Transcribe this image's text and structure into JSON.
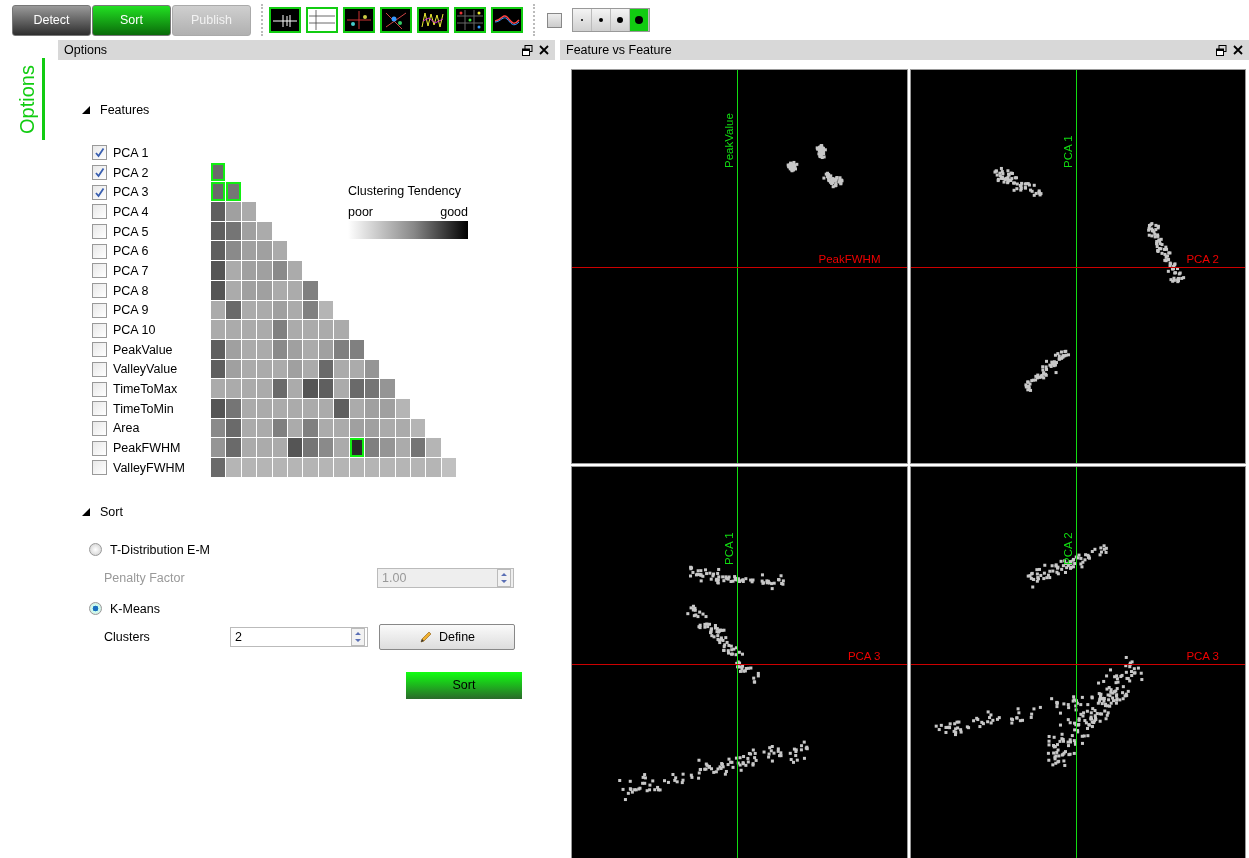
{
  "toolbar": {
    "modes": [
      {
        "label": "Detect",
        "selected": false,
        "disabled": false
      },
      {
        "label": "Sort",
        "selected": true,
        "disabled": false
      },
      {
        "label": "Publish",
        "selected": false,
        "disabled": true
      }
    ],
    "color_toggle": {
      "checked": false
    },
    "point_sizes": [
      {
        "selected": false
      },
      {
        "selected": false
      },
      {
        "selected": false
      },
      {
        "selected": true
      }
    ]
  },
  "side_tab": {
    "label": "Options",
    "selected": true
  },
  "options_panel": {
    "title": "Options",
    "features_section": {
      "title": "Features",
      "expanded": true
    },
    "features": [
      {
        "label": "PCA 1",
        "checked": true
      },
      {
        "label": "PCA 2",
        "checked": true,
        "cells": [
          {
            "color": "#6a6a6a",
            "selected": true
          }
        ]
      },
      {
        "label": "PCA 3",
        "checked": true,
        "cells": [
          {
            "color": "#6a6a6a",
            "selected": true
          },
          {
            "color": "#757575",
            "selected": true
          }
        ]
      },
      {
        "label": "PCA 4",
        "checked": false,
        "cells": [
          {
            "color": "#5f5f5f",
            "selected": false
          },
          {
            "color": "#a0a0a0",
            "selected": false
          },
          {
            "color": "#ababab",
            "selected": false
          }
        ]
      },
      {
        "label": "PCA 5",
        "checked": false,
        "cells": [
          {
            "color": "#5f5f5f",
            "selected": false
          },
          {
            "color": "#757575",
            "selected": false
          },
          {
            "color": "#a0a0a0",
            "selected": false
          },
          {
            "color": "#ababab",
            "selected": false
          }
        ]
      },
      {
        "label": "PCA 6",
        "checked": false,
        "cells": [
          {
            "color": "#5f5f5f",
            "selected": false
          },
          {
            "color": "#8a8a8a",
            "selected": false
          },
          {
            "color": "#a0a0a0",
            "selected": false
          },
          {
            "color": "#a0a0a0",
            "selected": false
          },
          {
            "color": "#ababab",
            "selected": false
          }
        ]
      },
      {
        "label": "PCA 7",
        "checked": false,
        "cells": [
          {
            "color": "#555555",
            "selected": false
          },
          {
            "color": "#ababab",
            "selected": false
          },
          {
            "color": "#a0a0a0",
            "selected": false
          },
          {
            "color": "#a0a0a0",
            "selected": false
          },
          {
            "color": "#8a8a8a",
            "selected": false
          },
          {
            "color": "#ababab",
            "selected": false
          }
        ]
      },
      {
        "label": "PCA 8",
        "checked": false,
        "cells": [
          {
            "color": "#555555",
            "selected": false
          },
          {
            "color": "#ababab",
            "selected": false
          },
          {
            "color": "#a0a0a0",
            "selected": false
          },
          {
            "color": "#a0a0a0",
            "selected": false
          },
          {
            "color": "#ababab",
            "selected": false
          },
          {
            "color": "#ababab",
            "selected": false
          },
          {
            "color": "#808080",
            "selected": false
          }
        ]
      },
      {
        "label": "PCA 9",
        "checked": false,
        "cells": [
          {
            "color": "#ababab",
            "selected": false
          },
          {
            "color": "#6a6a6a",
            "selected": false
          },
          {
            "color": "#ababab",
            "selected": false
          },
          {
            "color": "#ababab",
            "selected": false
          },
          {
            "color": "#a0a0a0",
            "selected": false
          },
          {
            "color": "#ababab",
            "selected": false
          },
          {
            "color": "#808080",
            "selected": false
          },
          {
            "color": "#b5b5b5",
            "selected": false
          }
        ]
      },
      {
        "label": "PCA 10",
        "checked": false,
        "cells": [
          {
            "color": "#ababab",
            "selected": false
          },
          {
            "color": "#ababab",
            "selected": false
          },
          {
            "color": "#ababab",
            "selected": false
          },
          {
            "color": "#ababab",
            "selected": false
          },
          {
            "color": "#808080",
            "selected": false
          },
          {
            "color": "#ababab",
            "selected": false
          },
          {
            "color": "#ababab",
            "selected": false
          },
          {
            "color": "#ababab",
            "selected": false
          },
          {
            "color": "#ababab",
            "selected": false
          }
        ]
      },
      {
        "label": "PeakValue",
        "checked": false,
        "cells": [
          {
            "color": "#5f5f5f",
            "selected": false
          },
          {
            "color": "#a0a0a0",
            "selected": false
          },
          {
            "color": "#ababab",
            "selected": false
          },
          {
            "color": "#ababab",
            "selected": false
          },
          {
            "color": "#8a8a8a",
            "selected": false
          },
          {
            "color": "#a0a0a0",
            "selected": false
          },
          {
            "color": "#ababab",
            "selected": false
          },
          {
            "color": "#a0a0a0",
            "selected": false
          },
          {
            "color": "#808080",
            "selected": false
          },
          {
            "color": "#808080",
            "selected": false
          }
        ]
      },
      {
        "label": "ValleyValue",
        "checked": false,
        "cells": [
          {
            "color": "#5f5f5f",
            "selected": false
          },
          {
            "color": "#a0a0a0",
            "selected": false
          },
          {
            "color": "#ababab",
            "selected": false
          },
          {
            "color": "#ababab",
            "selected": false
          },
          {
            "color": "#ababab",
            "selected": false
          },
          {
            "color": "#a0a0a0",
            "selected": false
          },
          {
            "color": "#ababab",
            "selected": false
          },
          {
            "color": "#6a6a6a",
            "selected": false
          },
          {
            "color": "#ababab",
            "selected": false
          },
          {
            "color": "#ababab",
            "selected": false
          },
          {
            "color": "#959595",
            "selected": false
          }
        ]
      },
      {
        "label": "TimeToMax",
        "checked": false,
        "cells": [
          {
            "color": "#ababab",
            "selected": false
          },
          {
            "color": "#ababab",
            "selected": false
          },
          {
            "color": "#ababab",
            "selected": false
          },
          {
            "color": "#ababab",
            "selected": false
          },
          {
            "color": "#6a6a6a",
            "selected": false
          },
          {
            "color": "#ababab",
            "selected": false
          },
          {
            "color": "#555555",
            "selected": false
          },
          {
            "color": "#5f5f5f",
            "selected": false
          },
          {
            "color": "#ababab",
            "selected": false
          },
          {
            "color": "#6a6a6a",
            "selected": false
          },
          {
            "color": "#757575",
            "selected": false
          },
          {
            "color": "#959595",
            "selected": false
          }
        ]
      },
      {
        "label": "TimeToMin",
        "checked": false,
        "cells": [
          {
            "color": "#555555",
            "selected": false
          },
          {
            "color": "#757575",
            "selected": false
          },
          {
            "color": "#ababab",
            "selected": false
          },
          {
            "color": "#ababab",
            "selected": false
          },
          {
            "color": "#ababab",
            "selected": false
          },
          {
            "color": "#ababab",
            "selected": false
          },
          {
            "color": "#ababab",
            "selected": false
          },
          {
            "color": "#ababab",
            "selected": false
          },
          {
            "color": "#5f5f5f",
            "selected": false
          },
          {
            "color": "#ababab",
            "selected": false
          },
          {
            "color": "#a0a0a0",
            "selected": false
          },
          {
            "color": "#a0a0a0",
            "selected": false
          },
          {
            "color": "#b5b5b5",
            "selected": false
          }
        ]
      },
      {
        "label": "Area",
        "checked": false,
        "cells": [
          {
            "color": "#8a8a8a",
            "selected": false
          },
          {
            "color": "#6a6a6a",
            "selected": false
          },
          {
            "color": "#ababab",
            "selected": false
          },
          {
            "color": "#ababab",
            "selected": false
          },
          {
            "color": "#808080",
            "selected": false
          },
          {
            "color": "#ababab",
            "selected": false
          },
          {
            "color": "#808080",
            "selected": false
          },
          {
            "color": "#ababab",
            "selected": false
          },
          {
            "color": "#ababab",
            "selected": false
          },
          {
            "color": "#a0a0a0",
            "selected": false
          },
          {
            "color": "#a0a0a0",
            "selected": false
          },
          {
            "color": "#ababab",
            "selected": false
          },
          {
            "color": "#ababab",
            "selected": false
          },
          {
            "color": "#b5b5b5",
            "selected": false
          }
        ]
      },
      {
        "label": "PeakFWHM",
        "checked": false,
        "cells": [
          {
            "color": "#959595",
            "selected": false
          },
          {
            "color": "#6a6a6a",
            "selected": false
          },
          {
            "color": "#ababab",
            "selected": false
          },
          {
            "color": "#ababab",
            "selected": false
          },
          {
            "color": "#ababab",
            "selected": false
          },
          {
            "color": "#555555",
            "selected": false
          },
          {
            "color": "#757575",
            "selected": false
          },
          {
            "color": "#8a8a8a",
            "selected": false
          },
          {
            "color": "#ababab",
            "selected": false
          },
          {
            "color": "#2a2a2a",
            "selected": true
          },
          {
            "color": "#808080",
            "selected": false
          },
          {
            "color": "#959595",
            "selected": false
          },
          {
            "color": "#ababab",
            "selected": false
          },
          {
            "color": "#757575",
            "selected": false
          },
          {
            "color": "#b5b5b5",
            "selected": false
          }
        ]
      },
      {
        "label": "ValleyFWHM",
        "checked": false,
        "cells": [
          {
            "color": "#6a6a6a",
            "selected": false
          },
          {
            "color": "#b5b5b5",
            "selected": false
          },
          {
            "color": "#b5b5b5",
            "selected": false
          },
          {
            "color": "#b5b5b5",
            "selected": false
          },
          {
            "color": "#b5b5b5",
            "selected": false
          },
          {
            "color": "#b5b5b5",
            "selected": false
          },
          {
            "color": "#b5b5b5",
            "selected": false
          },
          {
            "color": "#b5b5b5",
            "selected": false
          },
          {
            "color": "#b5b5b5",
            "selected": false
          },
          {
            "color": "#b5b5b5",
            "selected": false
          },
          {
            "color": "#b5b5b5",
            "selected": false
          },
          {
            "color": "#b5b5b5",
            "selected": false
          },
          {
            "color": "#b5b5b5",
            "selected": false
          },
          {
            "color": "#b5b5b5",
            "selected": false
          },
          {
            "color": "#b5b5b5",
            "selected": false
          },
          {
            "color": "#c0c0c0",
            "selected": false
          }
        ]
      }
    ],
    "legend": {
      "title": "Clustering Tendency",
      "low_label": "poor",
      "high_label": "good"
    },
    "sort_section": {
      "title": "Sort",
      "expanded": true
    },
    "methods": [
      {
        "label": "T-Distribution E-M",
        "selected": false,
        "param_label": "Penalty Factor",
        "param_value": "1.00"
      },
      {
        "label": "K-Means",
        "selected": true,
        "param_label": "Clusters",
        "param_value": "2",
        "button": "Define"
      }
    ],
    "sort_button": "Sort"
  },
  "feature_panel": {
    "title": "Feature vs Feature",
    "plots": [
      {
        "y_label": "PeakValue",
        "x_label": "PeakFWHM"
      },
      {
        "y_label": "PCA 1",
        "x_label": "PCA 2"
      },
      {
        "y_label": "PCA 1",
        "x_label": "PCA 3"
      },
      {
        "y_label": "PCA 2",
        "x_label": "PCA 3"
      }
    ]
  }
}
